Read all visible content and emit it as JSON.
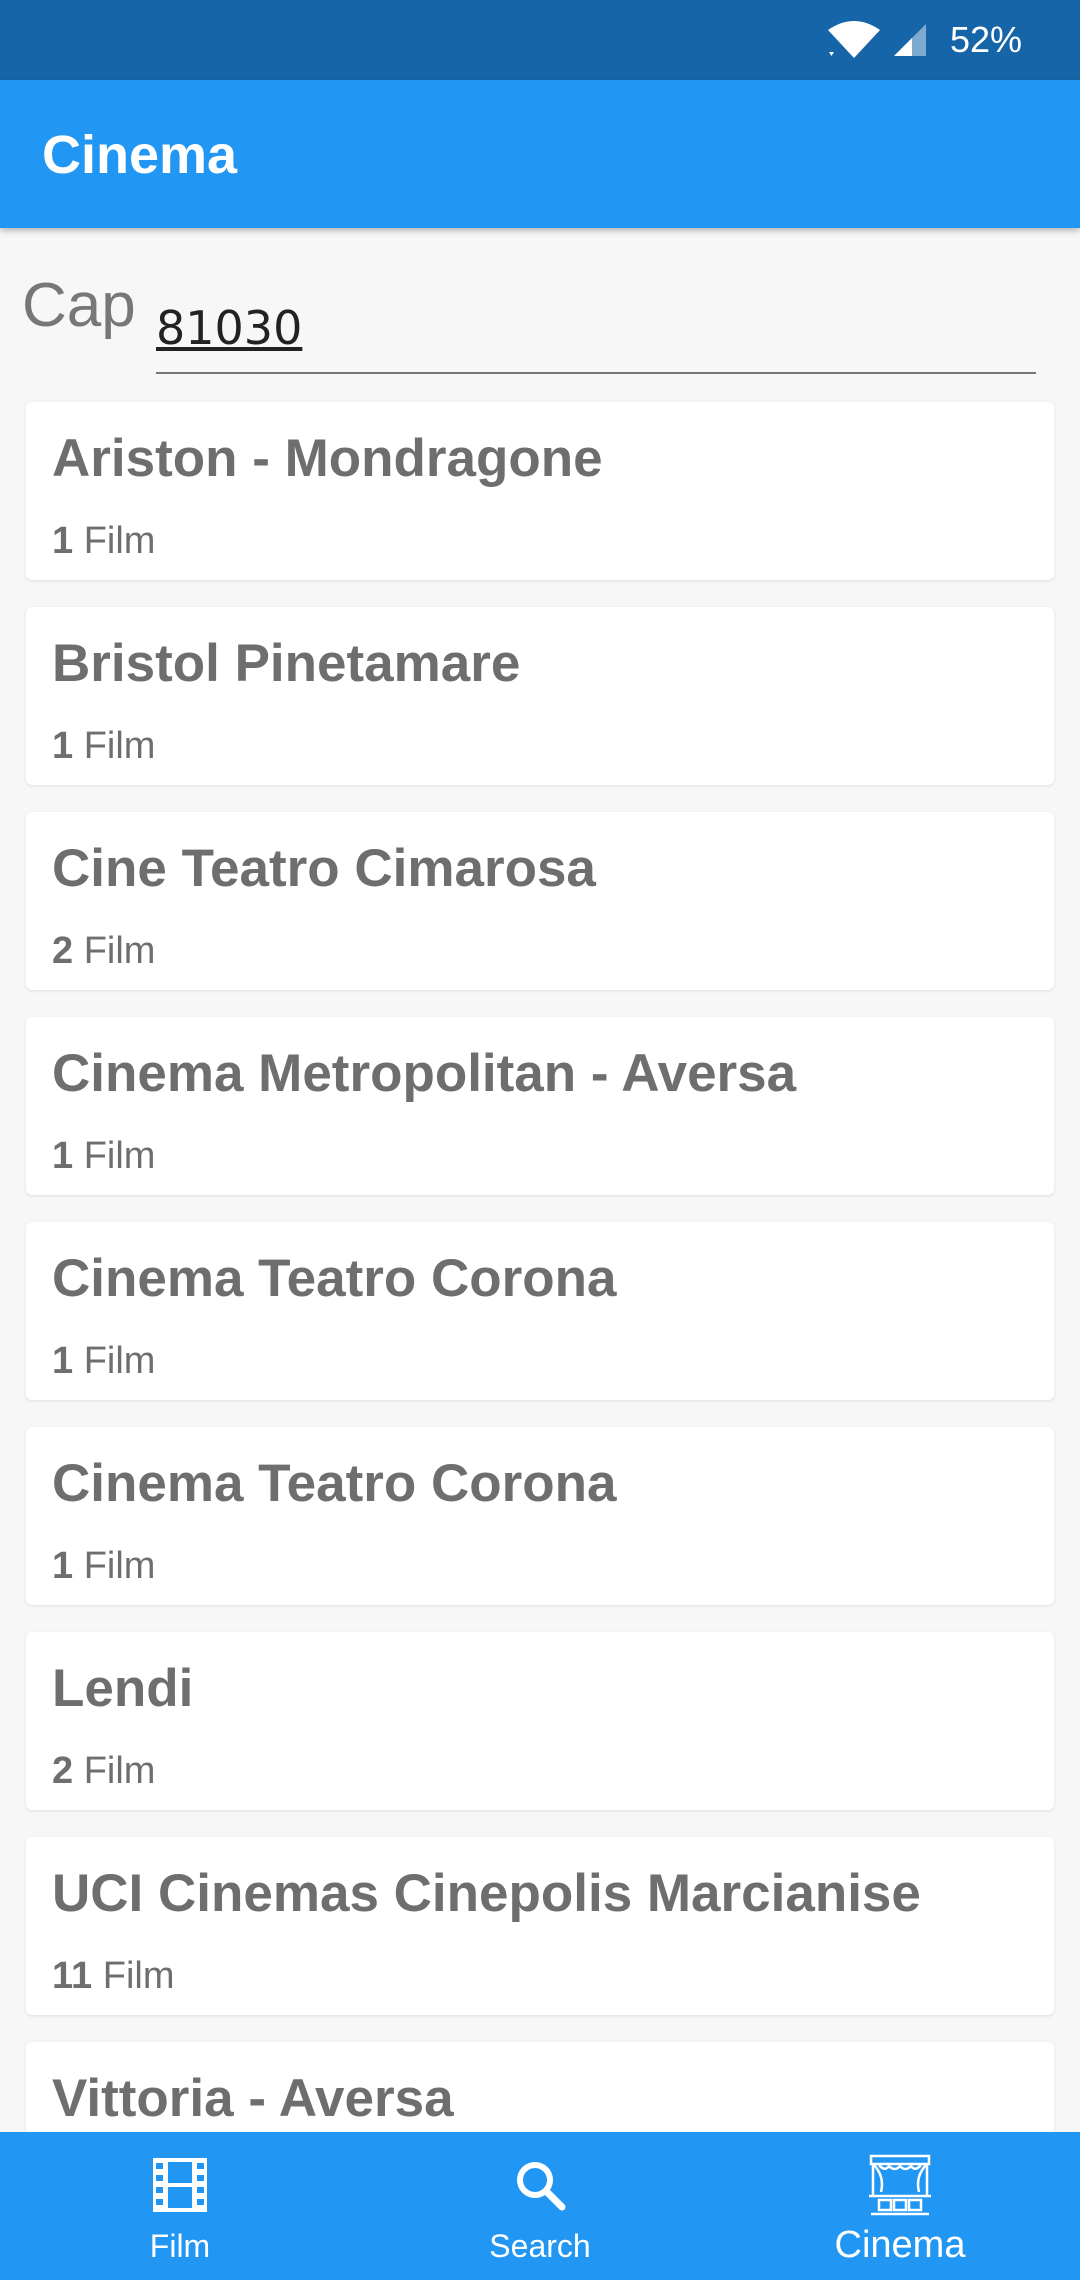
{
  "status_bar": {
    "battery": "52%",
    "icons": [
      "wifi-icon",
      "signal-icon"
    ]
  },
  "app_bar": {
    "title": "Cinema"
  },
  "search": {
    "label": "Cap",
    "value": "81030"
  },
  "cinemas": [
    {
      "name": "Ariston - Mondragone",
      "count": "1",
      "unit": "Film"
    },
    {
      "name": "Bristol Pinetamare",
      "count": "1",
      "unit": "Film"
    },
    {
      "name": "Cine Teatro Cimarosa",
      "count": "2",
      "unit": "Film"
    },
    {
      "name": "Cinema Metropolitan - Aversa",
      "count": "1",
      "unit": "Film"
    },
    {
      "name": "Cinema Teatro Corona",
      "count": "1",
      "unit": "Film"
    },
    {
      "name": "Cinema Teatro Corona",
      "count": "1",
      "unit": "Film"
    },
    {
      "name": "Lendi",
      "count": "2",
      "unit": "Film"
    },
    {
      "name": "UCI Cinemas Cinepolis Marcianise",
      "count": "11",
      "unit": "Film"
    },
    {
      "name": "Vittoria - Aversa",
      "count": "",
      "unit": ""
    }
  ],
  "bottom_nav": {
    "items": [
      {
        "label": "Film",
        "icon": "film-icon"
      },
      {
        "label": "Search",
        "icon": "search-icon"
      },
      {
        "label": "Cinema",
        "icon": "theater-icon",
        "active": true
      }
    ]
  },
  "colors": {
    "status_bar": "#1565a8",
    "primary": "#2196f3",
    "card_text": "#6e6e6e",
    "background": "#f7f7f7"
  }
}
